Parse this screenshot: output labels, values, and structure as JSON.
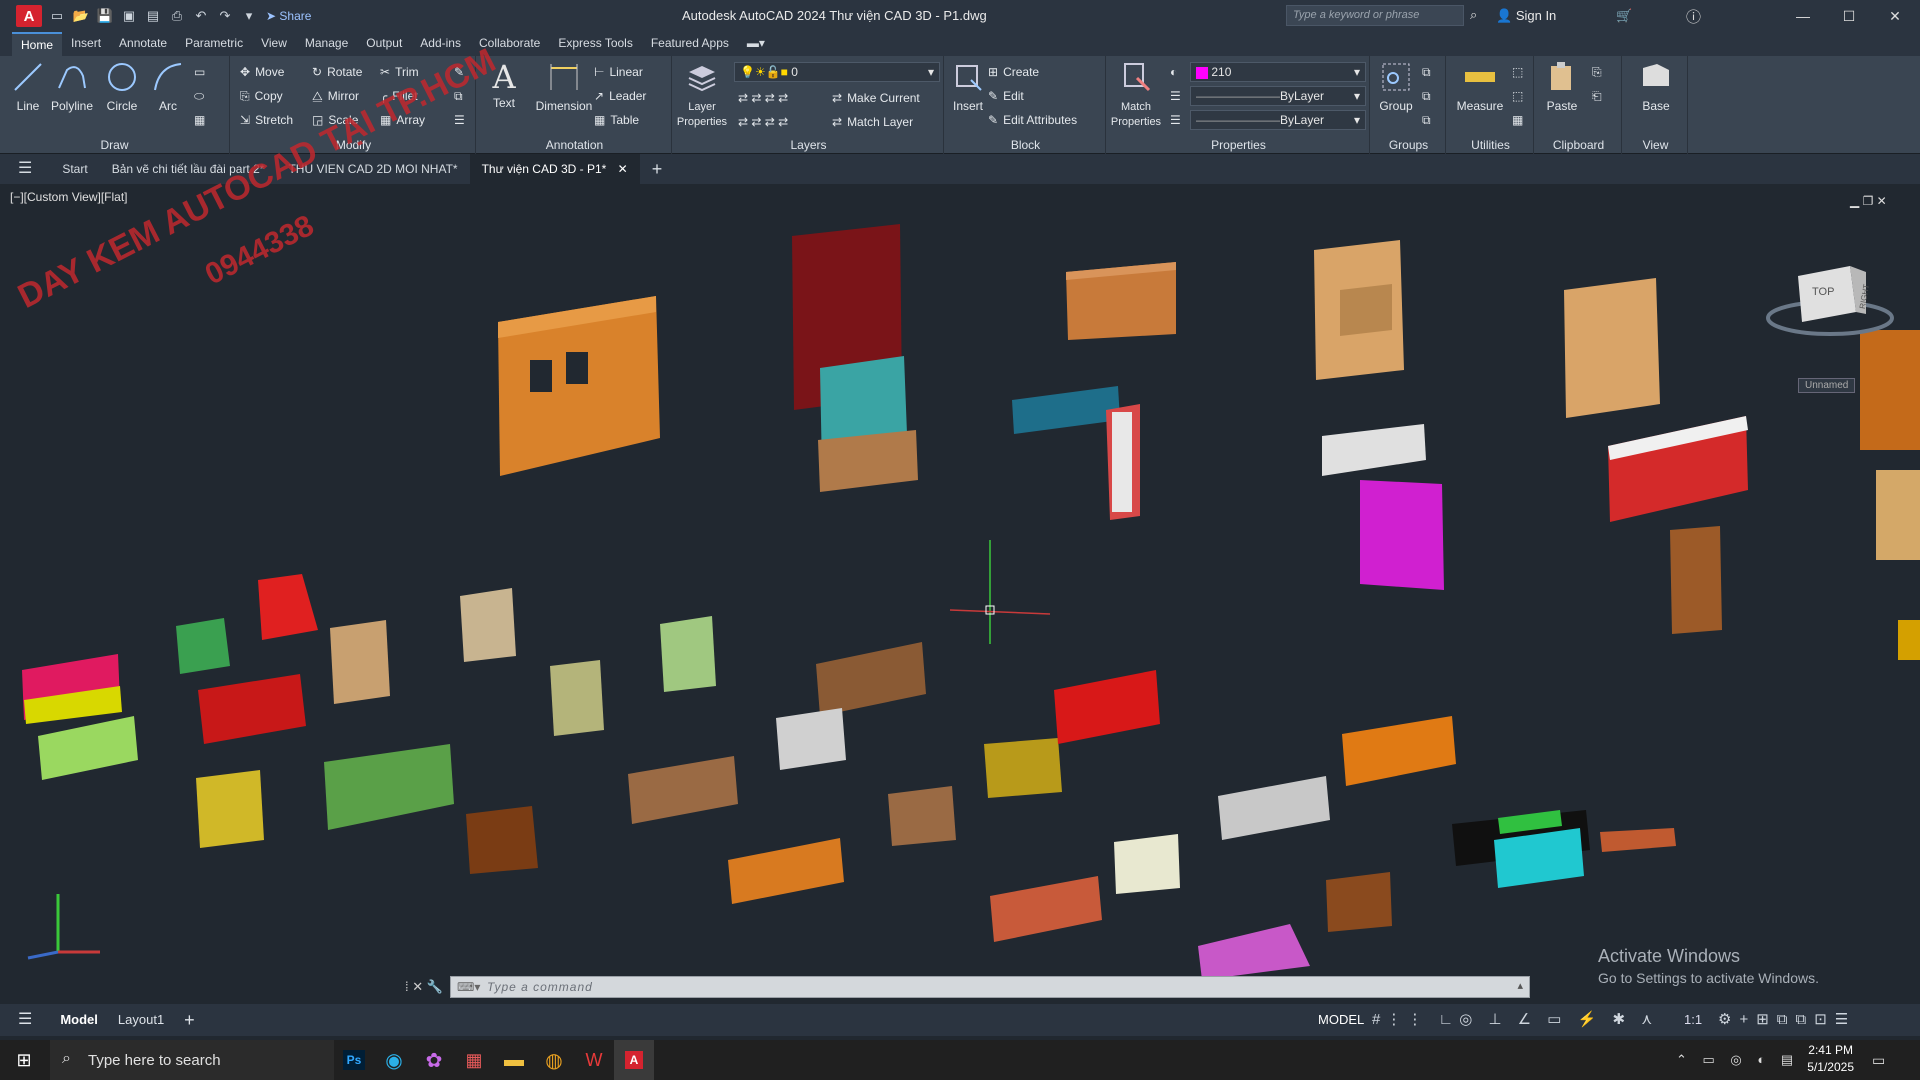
{
  "titlebar": {
    "app_title": "Autodesk AutoCAD 2024   Thư viện CAD 3D - P1.dwg",
    "share_label": "Share",
    "search_placeholder": "Type a keyword or phrase",
    "signin_label": "Sign In"
  },
  "ribbon_tabs": [
    "Home",
    "Insert",
    "Annotate",
    "Parametric",
    "View",
    "Manage",
    "Output",
    "Add-ins",
    "Collaborate",
    "Express Tools",
    "Featured Apps"
  ],
  "ribbon": {
    "draw": {
      "title": "Draw",
      "line": "Line",
      "polyline": "Polyline",
      "circle": "Circle",
      "arc": "Arc"
    },
    "modify": {
      "title": "Modify",
      "move": "Move",
      "rotate": "Rotate",
      "trim": "Trim",
      "copy": "Copy",
      "mirror": "Mirror",
      "fillet": "Fillet",
      "stretch": "Stretch",
      "scale": "Scale",
      "array": "Array"
    },
    "annotation": {
      "title": "Annotation",
      "text": "Text",
      "dimension": "Dimension",
      "linear": "Linear",
      "leader": "Leader",
      "table": "Table"
    },
    "layers": {
      "title": "Layers",
      "layer_properties": "Layer Properties",
      "layer_value": "0",
      "make_current": "Make Current",
      "match_layer": "Match Layer"
    },
    "block": {
      "title": "Block",
      "insert": "Insert",
      "create": "Create",
      "edit": "Edit",
      "edit_attributes": "Edit Attributes"
    },
    "properties": {
      "title": "Properties",
      "match_properties": "Match Properties",
      "color_value": "210",
      "linetype": "ByLayer",
      "lineweight": "ByLayer"
    },
    "groups": {
      "title": "Groups",
      "group": "Group"
    },
    "utilities": {
      "title": "Utilities",
      "measure": "Measure"
    },
    "clipboard": {
      "title": "Clipboard",
      "paste": "Paste"
    },
    "view": {
      "title": "View",
      "base": "Base"
    }
  },
  "file_tabs": [
    "Start",
    "Bản vẽ chi tiết lầu đài part 2*",
    "THU VIEN CAD 2D MOI NHAT*",
    "Thư viện CAD 3D - P1*"
  ],
  "viewport": {
    "view_label": "[−][Custom View][Flat]",
    "watermark_line1": "DAY KEM AUTOCAD TẠI TP.HCM",
    "watermark_line2": "0944338",
    "viewcube_top": "TOP",
    "viewcube_right": "RIGHT",
    "unnamed": "Unnamed"
  },
  "activate": {
    "line1": "Activate Windows",
    "line2": "Go to Settings to activate Windows."
  },
  "command": {
    "placeholder": "Type a command"
  },
  "layout_tabs": [
    "Model",
    "Layout1"
  ],
  "status": {
    "model": "MODEL",
    "scale": "1:1"
  },
  "taskbar": {
    "search": "Type here to search",
    "time": "2:41 PM",
    "date": "5/1/2025"
  },
  "colors": {
    "accent": "#4a90d9",
    "bg": "#212830",
    "ribbon": "#3a4552",
    "brand": "#d5232f"
  }
}
